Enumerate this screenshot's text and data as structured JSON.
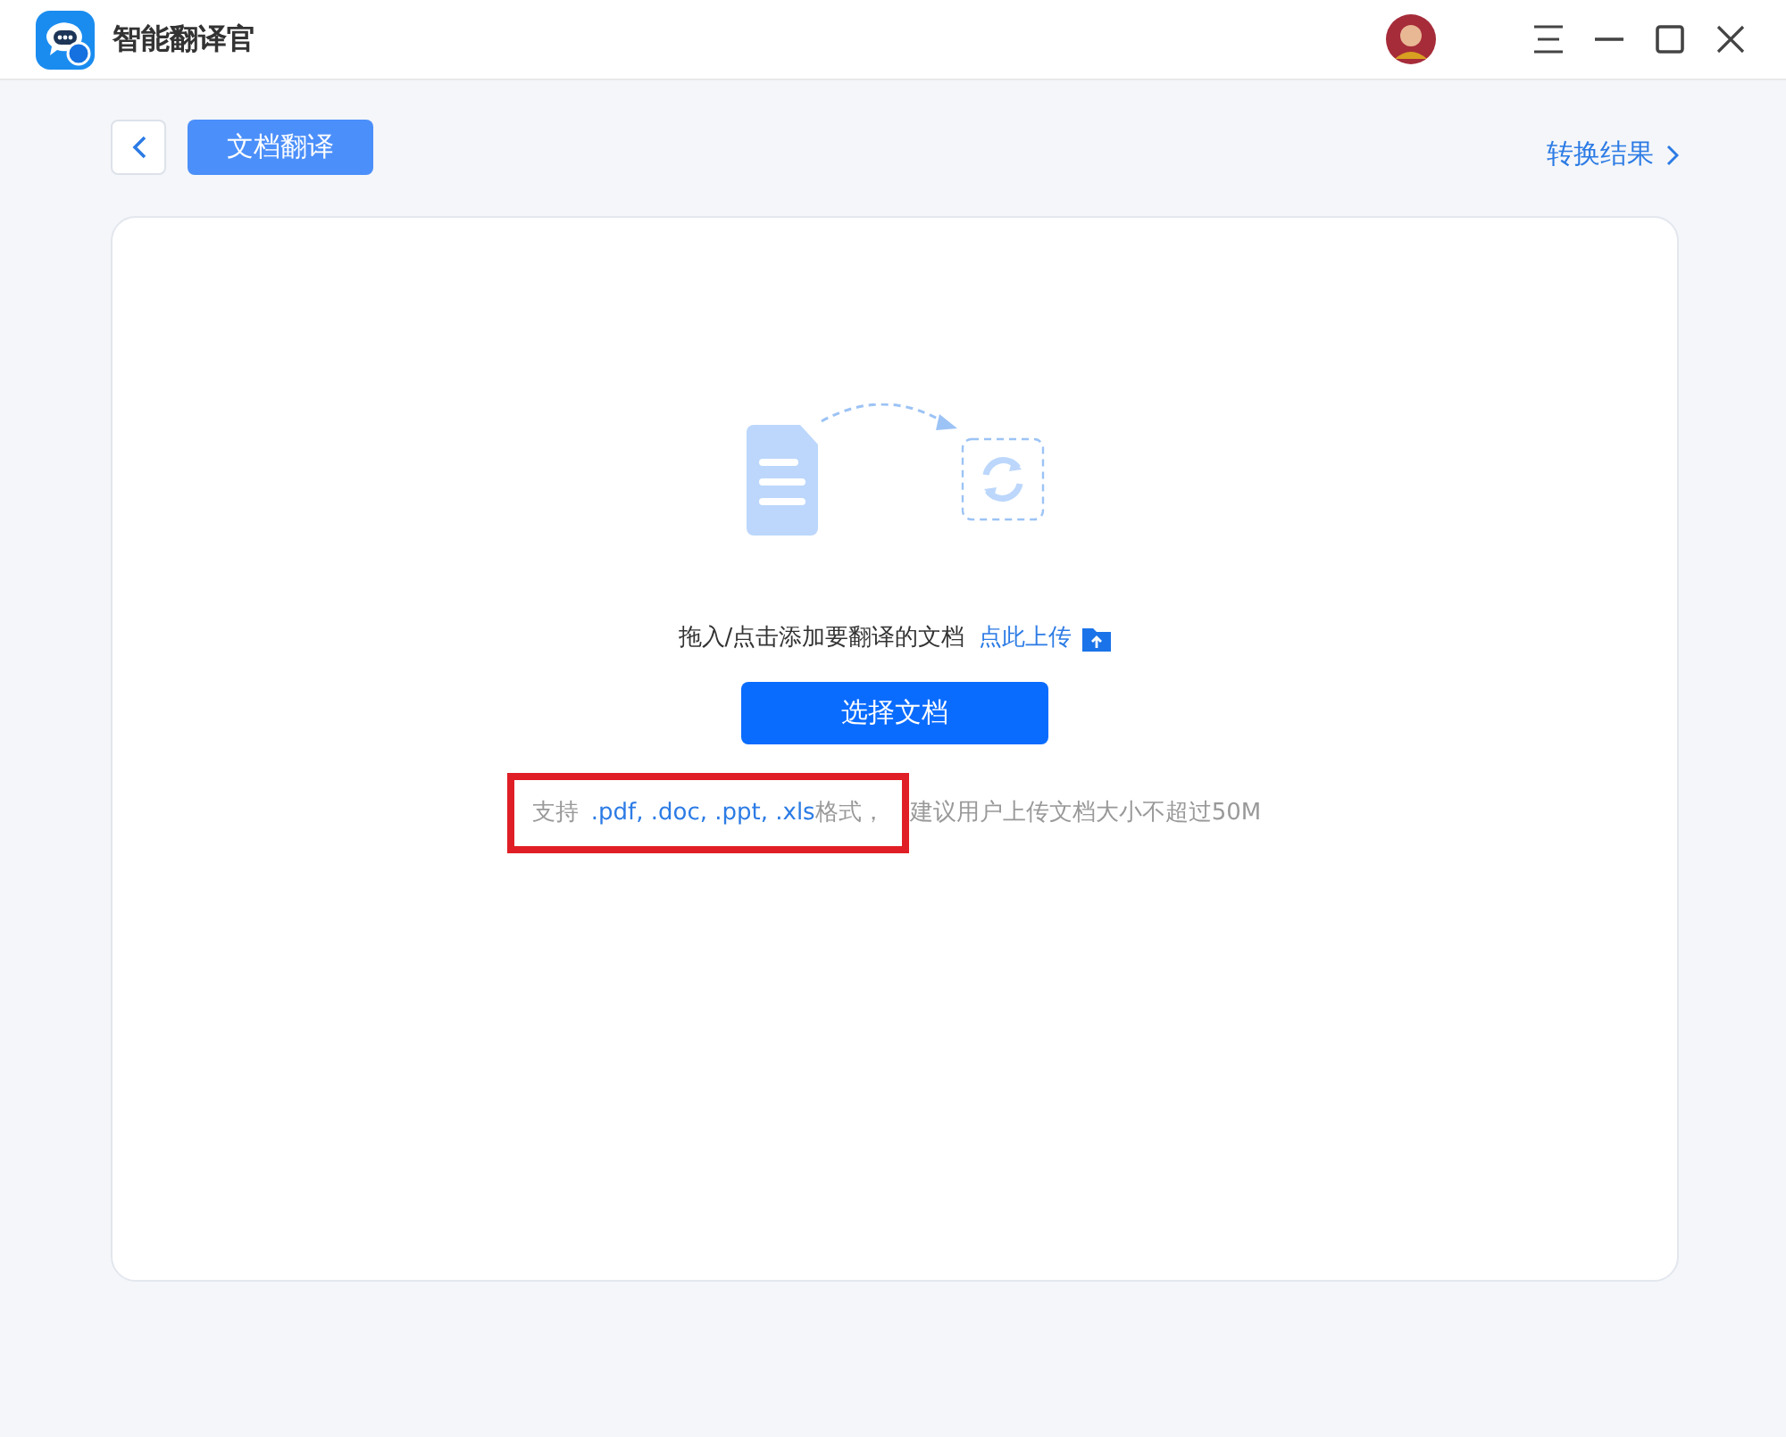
{
  "window": {
    "title": "智能翻译官"
  },
  "toolbar": {
    "tab": "文档翻译",
    "results_link": "转换结果"
  },
  "upload": {
    "instruction": "拖入/点击添加要翻译的文档",
    "upload_link": "点此上传",
    "button": "选择文档",
    "hint": {
      "prefix": "支持",
      "formats": ".pdf, .doc, .ppt, .xls",
      "suffix": "格式，",
      "note": "建议用户上传文档大小不超过50M",
      "highlighted": true
    }
  }
}
